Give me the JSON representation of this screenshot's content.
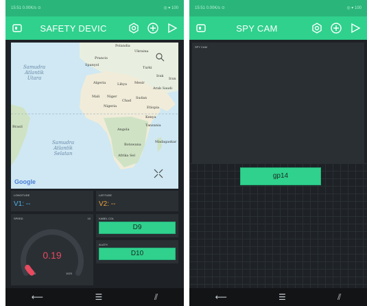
{
  "left_screen": {
    "statusbar": {
      "left": "15:51 0.00K/s ⊙",
      "right": "◎ ▾ 100"
    },
    "appbar": {
      "title": "SAFETY DEVIC",
      "icons": [
        "device-icon",
        "nut-icon",
        "add-icon",
        "play-icon"
      ]
    },
    "map": {
      "ocean_labels": [
        "Samudra\nAtlantik\nUtara",
        "Samudra\nAtlantik\nSelatan"
      ],
      "country_labels": [
        "Polandia",
        "Ukraina",
        "Prancis",
        "Spanyol",
        "Turki",
        "Irak",
        "Iran",
        "Algeria",
        "Libya",
        "Mesir",
        "Arab Saudi",
        "Mali",
        "Niger",
        "Chad",
        "Sudan",
        "Nigeria",
        "Etiopia",
        "Kenya",
        "Tanzania",
        "Angola",
        "Brasil",
        "Botswana",
        "Madagaskar",
        "Afrika Sel"
      ],
      "google_logo": "Google",
      "colors": {
        "ocean": "#cfe8f3",
        "land": "#e9efe0",
        "desert": "#f1ecd9",
        "green": "#cfe3c4"
      }
    },
    "longitude": {
      "label": "LONGITUDE",
      "value": "V1: --"
    },
    "latitude": {
      "label": "LATITUDE",
      "value": "V2: --"
    },
    "speed": {
      "label": "SPEED",
      "corner": "10",
      "value": "0.19",
      "min": "0",
      "max": "1023",
      "level": 0.05
    },
    "kabel": {
      "label": "KABEL COL",
      "button": "D9"
    },
    "alarm": {
      "label": "ALATH",
      "button": "D10"
    },
    "navbar": {
      "back": "⟵",
      "home": "☰",
      "recent": "⫽"
    }
  },
  "right_screen": {
    "statusbar": {
      "left": "15:51 0.00K/s ⊙",
      "right": "◎ ▾ 100"
    },
    "appbar": {
      "title": "SPY CAM",
      "icons": [
        "device-icon",
        "nut-icon",
        "add-icon",
        "play-icon"
      ]
    },
    "cam": {
      "label": "SPY CAM"
    },
    "button": {
      "label": "gp14"
    },
    "navbar": {
      "back": "⟵",
      "home": "☰",
      "recent": "⫽"
    }
  }
}
